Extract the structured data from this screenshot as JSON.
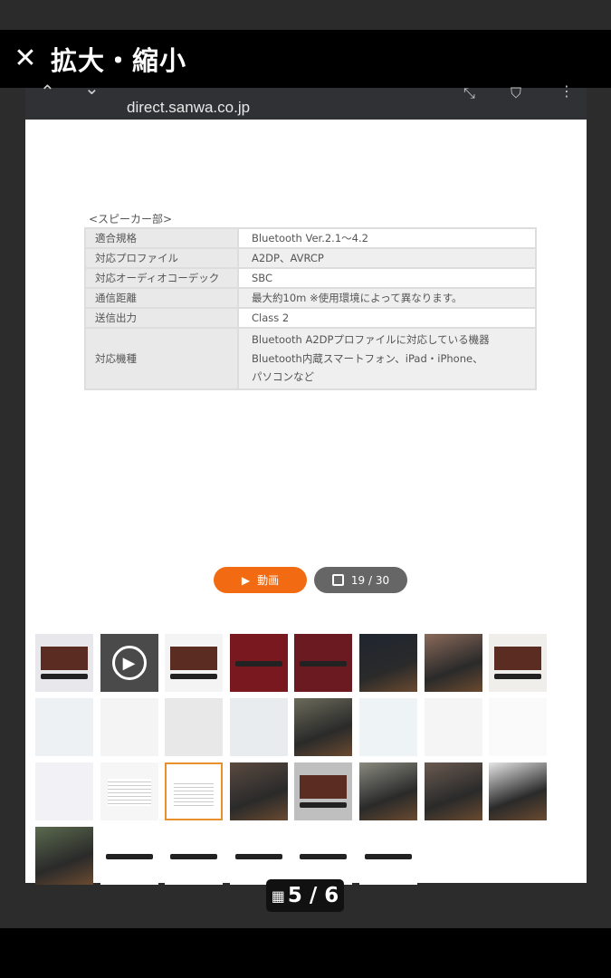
{
  "title_bar": {
    "title": "拡大・縮小",
    "close_icon": "close-icon"
  },
  "browser": {
    "url": "direct.sanwa.co.jp"
  },
  "spec": {
    "heading": "<スピーカー部>",
    "rows": [
      {
        "key": "適合規格",
        "value": [
          "Bluetooth Ver.2.1〜4.2"
        ]
      },
      {
        "key": "対応プロファイル",
        "value": [
          "A2DP、AVRCP"
        ]
      },
      {
        "key": "対応オーディオコーデック",
        "value": [
          "SBC"
        ]
      },
      {
        "key": "通信距離",
        "value": [
          "最大約10m ※使用環境によって異なります。"
        ]
      },
      {
        "key": "送信出力",
        "value": [
          "Class 2"
        ]
      },
      {
        "key": "対応機種",
        "value": [
          "Bluetooth A2DPプロファイルに対応している機器",
          "Bluetooth内蔵スマートフォン、iPad・iPhone、",
          "パソコンなど"
        ]
      }
    ]
  },
  "buttons": {
    "video": "動画",
    "gallery": "19 / 30"
  },
  "thumbnails": [
    {
      "bg": "#e8e8ec",
      "kind": "tv"
    },
    {
      "bg": "#4a4a4a",
      "kind": "play"
    },
    {
      "bg": "#f4f4f4",
      "kind": "tv"
    },
    {
      "bg": "#7a1820",
      "kind": "bar"
    },
    {
      "bg": "#6b1a22",
      "kind": "bar"
    },
    {
      "bg": "#1f2530",
      "kind": "photo"
    },
    {
      "bg": "#8a6a5a",
      "kind": "photo"
    },
    {
      "bg": "#f0eeea",
      "kind": "tv"
    },
    {
      "bg": "#eef1f4",
      "kind": "chart"
    },
    {
      "bg": "#f4f4f4",
      "kind": "remote"
    },
    {
      "bg": "#e8e8e8",
      "kind": "remote"
    },
    {
      "bg": "#e9ecef",
      "kind": "chart"
    },
    {
      "bg": "#6b6b5a",
      "kind": "photo"
    },
    {
      "bg": "#eef3f6",
      "kind": "chart"
    },
    {
      "bg": "#f5f5f5",
      "kind": "bars"
    },
    {
      "bg": "#fafafa",
      "kind": "cables"
    },
    {
      "bg": "#f2f2f6",
      "kind": "chart"
    },
    {
      "bg": "#f6f6f6",
      "kind": "doc"
    },
    {
      "bg": "#ffffff",
      "kind": "doc",
      "selected": true
    },
    {
      "bg": "#5a4a40",
      "kind": "photo"
    },
    {
      "bg": "#bfbfbf",
      "kind": "tv"
    },
    {
      "bg": "#8a8a80",
      "kind": "photo"
    },
    {
      "bg": "#6a5a50",
      "kind": "photo"
    },
    {
      "bg": "#e6e6e6",
      "kind": "photo"
    },
    {
      "bg": "#5b6a4e",
      "kind": "photo"
    },
    {
      "bg": "#ffffff",
      "kind": "bar"
    },
    {
      "bg": "#ffffff",
      "kind": "bar"
    },
    {
      "bg": "#ffffff",
      "kind": "bar"
    },
    {
      "bg": "#ffffff",
      "kind": "bar"
    },
    {
      "bg": "#ffffff",
      "kind": "bar"
    }
  ],
  "pager": {
    "label": "5 / 6",
    "icon": "grid-icon"
  },
  "colors": {
    "accent": "#f26b12",
    "selected_border": "#e8912c"
  }
}
